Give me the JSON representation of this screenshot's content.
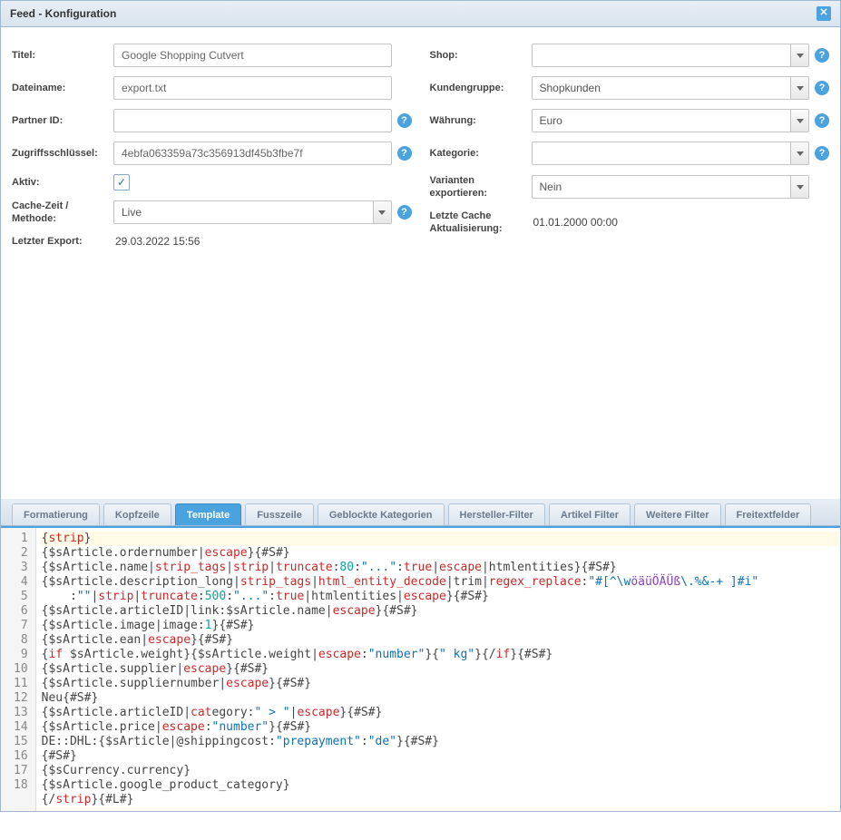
{
  "window": {
    "title": "Feed - Konfiguration"
  },
  "left": {
    "titel_label": "Titel:",
    "titel_value": "Google Shopping Cutvert",
    "dateiname_label": "Dateiname:",
    "dateiname_value": "export.txt",
    "partner_label": "Partner ID:",
    "partner_value": "",
    "zugriff_label": "Zugriffsschlüssel:",
    "zugriff_value": "4ebfa063359a73c356913df45b3fbe7f",
    "aktiv_label": "Aktiv:",
    "aktiv_checked": "✓",
    "cache_label": "Cache-Zeit / Methode:",
    "cache_value": "Live",
    "export_label": "Letzter Export:",
    "export_value": "29.03.2022 15:56"
  },
  "right": {
    "shop_label": "Shop:",
    "shop_value": "",
    "kunden_label": "Kundengruppe:",
    "kunden_value": "Shopkunden",
    "waehrung_label": "Währung:",
    "waehrung_value": "Euro",
    "kategorie_label": "Kategorie:",
    "kategorie_value": "",
    "varianten_label": "Varianten exportieren:",
    "varianten_value": "Nein",
    "letzteCache_label": "Letzte Cache Aktualisierung:",
    "letzteCache_value": "01.01.2000 00:00"
  },
  "tabs": {
    "t0": "Formatierung",
    "t1": "Kopfzeile",
    "t2": "Template",
    "t3": "Fusszeile",
    "t4": "Geblockte Kategorien",
    "t5": "Hersteller-Filter",
    "t6": "Artikel Filter",
    "t7": "Weitere Filter",
    "t8": "Freitextfelder"
  },
  "code_lines": 18,
  "code_template_raw": [
    "{strip}",
    "{$sArticle.ordernumber|escape}{#S#}",
    "{$sArticle.name|strip_tags|strip|truncate:80:\"...\":true|escape|htmlentities}{#S#}",
    "{$sArticle.description_long|strip_tags|html_entity_decode|trim|regex_replace:\"#[^\\wöäüÖÄÜß\\.%&-+ ]#i\":\"\"|strip|truncate:500:\"...\":true|htmlentities|escape}{#S#}",
    "{$sArticle.articleID|link:$sArticle.name|escape}{#S#}",
    "{$sArticle.image|image:1}{#S#}",
    "{$sArticle.ean|escape}{#S#}",
    "{if $sArticle.weight}{$sArticle.weight|escape:\"number\"}{\" kg\"}{/if}{#S#}",
    "{$sArticle.supplier|escape}{#S#}",
    "{$sArticle.suppliernumber|escape}{#S#}",
    "Neu{#S#}",
    "{$sArticle.articleID|category:\" > \"|escape}{#S#}",
    "{$sArticle.price|escape:\"number\"}{#S#}",
    "DE::DHL:{$sArticle|@shippingcost:\"prepayment\":\"de\"}{#S#}",
    "{#S#}",
    "{$sCurrency.currency}",
    "{$sArticle.google_product_category}",
    "{/strip}{#L#}"
  ]
}
